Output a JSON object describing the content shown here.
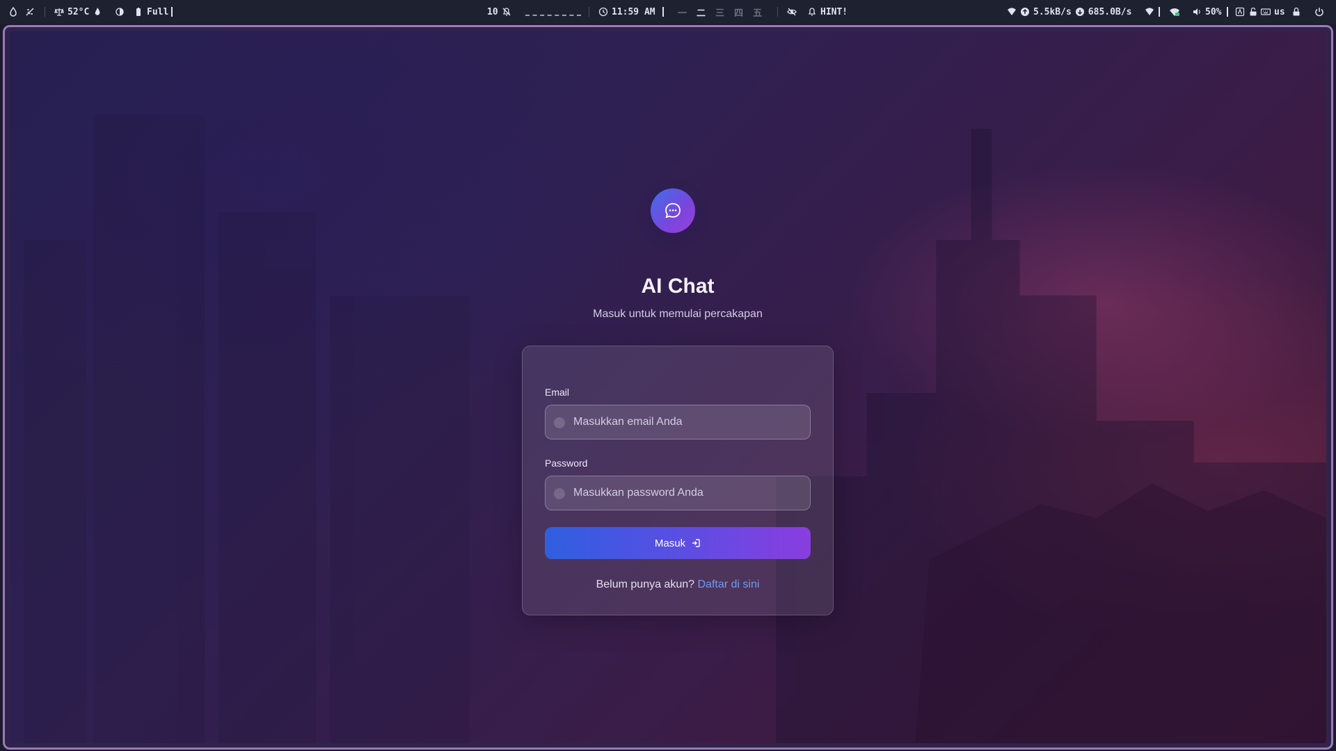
{
  "statusbar": {
    "temperature": "52°C",
    "battery_label": "Full",
    "workspace_number": "10",
    "clock": "11:59 AM",
    "layout_glyphs": [
      "一",
      "二",
      "三",
      "四",
      "五"
    ],
    "hint_label": "HINT!",
    "upload_speed": "5.5kB/s",
    "download_speed": "685.0B/s",
    "volume": "50%",
    "keyboard_layout": "us"
  },
  "login": {
    "app_title": "AI Chat",
    "subtitle": "Masuk untuk memulai percakapan",
    "email_label": "Email",
    "email_placeholder": "Masukkan email Anda",
    "email_value": "",
    "password_label": "Password",
    "password_placeholder": "Masukkan password Anda",
    "password_value": "",
    "submit_label": "Masuk",
    "register_prompt": "Belum punya akun?",
    "register_link": "Daftar di sini"
  },
  "colors": {
    "accent_blue": "#2f5fe0",
    "accent_purple": "#8a3ddf",
    "link": "#6f9cf2",
    "window_border": "#9a7bb8",
    "statusbar_bg": "#1e2130"
  },
  "icons": {
    "logo": "chat-bubble-icon",
    "submit": "login-arrow-icon"
  }
}
